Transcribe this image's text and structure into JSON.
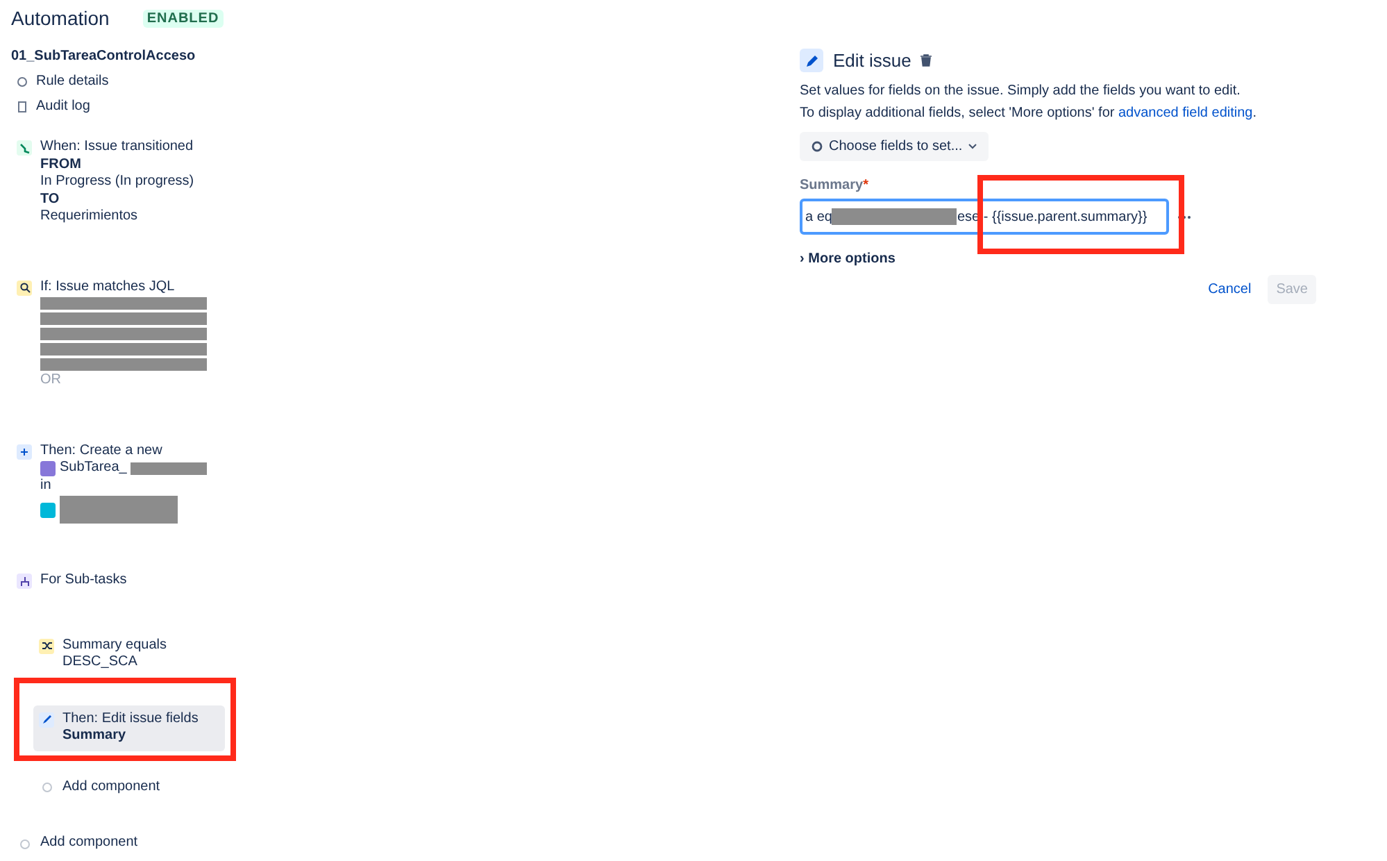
{
  "header": {
    "title": "Automation",
    "status": "ENABLED"
  },
  "rule": {
    "name": "01_SubTareaControlAcceso",
    "links": [
      {
        "kind": "details",
        "label": "Rule details"
      },
      {
        "kind": "log",
        "label": "Audit log"
      }
    ]
  },
  "components": [
    {
      "kind": "trigger",
      "lines": [
        "When: Issue transitioned",
        "**FROM**",
        "In Progress (In progress)",
        "**TO**",
        "Requerimientos"
      ],
      "selected": false
    },
    {
      "kind": "jql",
      "lines": [
        "If: Issue matches JQL"
      ],
      "tail": "OR",
      "selected": false
    },
    {
      "kind": "create",
      "lines": [
        "Then: Create a new"
      ],
      "issue_type": "SubTarea_",
      "connector": "in",
      "selected": false
    },
    {
      "kind": "branch",
      "lines": [
        "For Sub-tasks"
      ],
      "selected": false,
      "children": [
        {
          "kind": "condition",
          "lines": [
            "Summary equals",
            "DESC_SCA"
          ],
          "selected": false
        },
        {
          "kind": "edit",
          "lines": [
            "Then: Edit issue fields",
            "**Summary**"
          ],
          "selected": true,
          "annotated": true
        },
        {
          "kind": "add",
          "lines": [
            "Add component"
          ],
          "selected": false
        }
      ]
    },
    {
      "kind": "add",
      "lines": [
        "Add component"
      ],
      "selected": false
    }
  ],
  "panel": {
    "title": "Edit issue",
    "description": "Set values for fields on the issue. Simply add the fields you want to edit.",
    "hint": "To display additional fields, select 'More options' for",
    "hint_link": "advanced field editing",
    "hint_end": ".",
    "choose_button": "Choose fields to set...",
    "field": {
      "label": "Summary",
      "required_mark": "*",
      "value_start": "a eq",
      "value_end": "ese - {{issue.parent.summary}}",
      "annotated": true
    },
    "more_options_marker": "›",
    "more_options": "More options",
    "cancel": "Cancel",
    "save": "Save",
    "save_disabled": true
  }
}
